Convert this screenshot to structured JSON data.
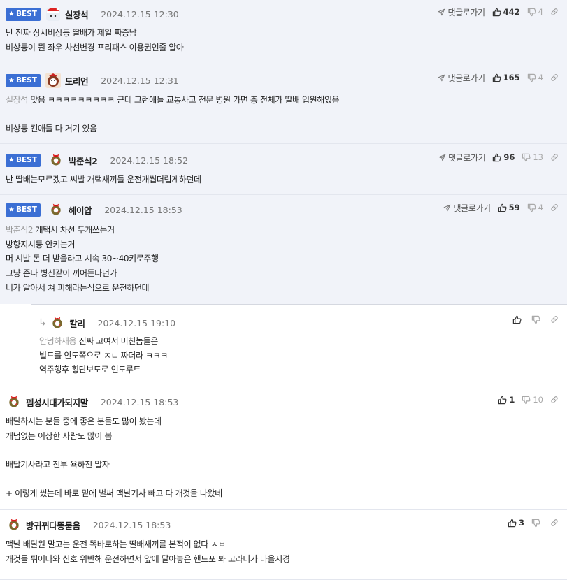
{
  "best_label": "BEST",
  "goto_label": "댓글로가기",
  "comments": [
    {
      "nick": "실장석",
      "date": "2024.12.15 12:30",
      "likes": "442",
      "dislikes": "4",
      "lines": [
        "난 진짜 상시비상등 딸배가 제일 짜증남",
        "비상등이 뭔 좌우 차선변경 프리패스 이용권인줄 알아"
      ]
    },
    {
      "nick": "도리언",
      "date": "2024.12.15 12:31",
      "likes": "165",
      "dislikes": "4",
      "mention": "실장석",
      "lines": [
        " 맞음 ㅋㅋㅋㅋㅋㅋㅋㅋㅋ 근데 그런애들 교통사고 전문 병원 가면 층 전체가 딸배 입원해있음",
        "",
        "비상등 킨애들 다 거기 있음"
      ]
    },
    {
      "nick": "박춘식2",
      "date": "2024.12.15 18:52",
      "likes": "96",
      "dislikes": "13",
      "lines": [
        "난 딸배는모르겠고 씨발 개택새끼들 운전개씹더럽게하던데"
      ]
    },
    {
      "nick": "헤이압",
      "date": "2024.12.15 18:53",
      "likes": "59",
      "dislikes": "4",
      "mention": "박춘식2",
      "lines": [
        " 개택시 차선 두개쓰는거",
        "방향지시등 안키는거",
        "머 시발 돈 더 받을라고 시속 30~40키로주행",
        "그냥 존나 병신같이 끼어든다던가",
        "니가 알아서 쳐 피해라는식으로 운전하던데"
      ]
    },
    {
      "nick": "칼리",
      "date": "2024.12.15 19:10",
      "mention": "안녕하새옹",
      "lines": [
        " 진짜 고여서 미친놈들은",
        "빌드를 인도쪽으로 ㅈㄴ 짜더라 ㅋㅋㅋ",
        "역주행후 횡단보도로 인도루트"
      ]
    },
    {
      "nick": "펨성시대가되지말",
      "date": "2024.12.15 18:53",
      "likes": "1",
      "dislikes": "10",
      "lines": [
        "배달하시는 분들 중에 좋은 분들도 많이 봤는데",
        "개념없는 이상한 사람도 많이 봄",
        "",
        "배달기사라고 전부 욕하진 말자",
        "",
        "+ 이렇게 썼는데 바로 밑에 벌써 맥날기사 빼고 다 개것들 나왔네"
      ]
    },
    {
      "nick": "방귀뀌다똥묻음",
      "date": "2024.12.15 18:53",
      "likes": "3",
      "lines": [
        "맥날 배달원 말고는 운전 똑바로하는 딸배새끼를 본적이 없다 ㅅㅂ",
        "개것들 튀어나와 신호 위반해 운전하면서 앞에 달아놓은 핸드포 봐 고라니가 나을지경"
      ]
    }
  ]
}
